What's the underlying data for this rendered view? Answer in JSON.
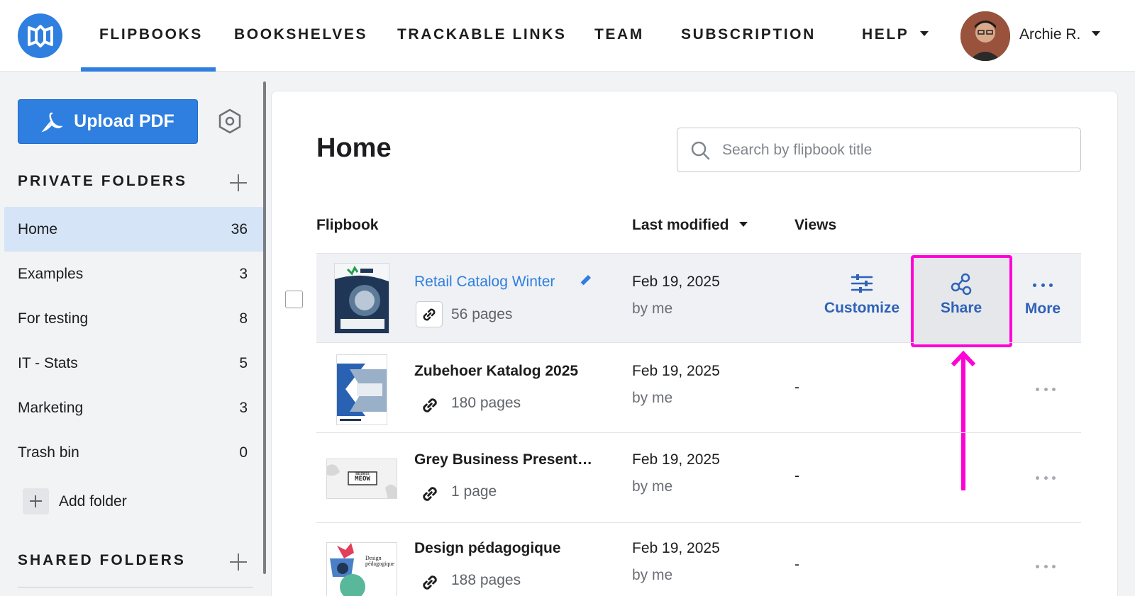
{
  "nav": {
    "items": [
      "FLIPBOOKS",
      "BOOKSHELVES",
      "TRACKABLE LINKS",
      "TEAM",
      "SUBSCRIPTION",
      "HELP"
    ],
    "user": "Archie R."
  },
  "sidebar": {
    "upload_label": "Upload PDF",
    "private_title": "PRIVATE FOLDERS",
    "folders": [
      {
        "name": "Home",
        "count": "36"
      },
      {
        "name": "Examples",
        "count": "3"
      },
      {
        "name": "For testing",
        "count": "8"
      },
      {
        "name": "IT - Stats",
        "count": "5"
      },
      {
        "name": "Marketing",
        "count": "3"
      },
      {
        "name": "Trash bin",
        "count": "0"
      }
    ],
    "add_folder": "Add folder",
    "shared_title": "SHARED FOLDERS"
  },
  "main": {
    "title": "Home",
    "search_placeholder": "Search by flipbook title",
    "columns": {
      "flipbook": "Flipbook",
      "modified": "Last modified",
      "views": "Views"
    },
    "rows": [
      {
        "title": "Retail Catalog Winter",
        "pages": "56 pages",
        "date": "Feb 19, 2025",
        "by": "by me",
        "views": ""
      },
      {
        "title": "Zubehoer Katalog 2025",
        "pages": "180 pages",
        "date": "Feb 19, 2025",
        "by": "by me",
        "views": "-"
      },
      {
        "title": "Grey Business Present…",
        "pages": "1 page",
        "date": "Feb 19, 2025",
        "by": "by me",
        "views": "-"
      },
      {
        "title": "Design pédagogique",
        "pages": "188 pages",
        "date": "Feb 19, 2025",
        "by": "by me",
        "views": "-"
      }
    ],
    "actions": {
      "customize": "Customize",
      "share": "Share",
      "more": "More"
    },
    "thumb_text": {
      "meow_small": "BUSINESS",
      "meow": "MEOW",
      "design": "Design pédagogique"
    }
  },
  "colors": {
    "accent": "#2f7fe0",
    "highlight": "#ff00d6",
    "active_folder": "#d5e4f7"
  }
}
